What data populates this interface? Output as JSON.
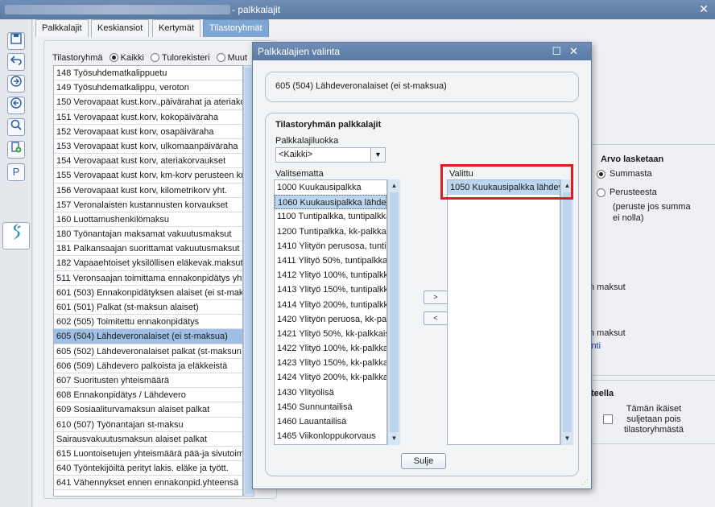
{
  "window": {
    "title": "- palkkalajit",
    "close_label": "✕"
  },
  "toolbar_icons": [
    "save-icon",
    "undo-icon",
    "forward-icon",
    "back-icon",
    "search-icon",
    "add-page-icon",
    "p-icon",
    "app-logo-icon"
  ],
  "toolbar_p_label": "P",
  "tabs": [
    {
      "label": "Palkkalajit",
      "active": false
    },
    {
      "label": "Keskiansiot",
      "active": false
    },
    {
      "label": "Kertymät",
      "active": false
    },
    {
      "label": "Tilastoryhmät",
      "active": true
    }
  ],
  "left_panel": {
    "filter_label": "Tilastoryhmä",
    "filter_options": [
      "Kaikki",
      "Tulorekisteri",
      "Muut"
    ],
    "rows": [
      "148 Työsuhdematkalippuetu",
      "149 Työsuhdematkalippu, veroton",
      "150 Verovapaat kust.korv.,päivärahat ja ateriako",
      "151 Verovapaat kust.korv, kokopäiväraha",
      "152 Verovapaat kust korv, osapäiväraha",
      "153 Verovapaat kust korv, ulkomaanpäiväraha",
      "154 Verovapaat kust korv, ateriakorvaukset",
      "155 Verovapaat kust korv, km-korv perusteen kr",
      "156 Verovapaat kust korv, kilometrikorv yht.",
      "157 Veronalaisten kustannusten korvaukset",
      "160 Luottamushenkilömaksu",
      "180 Työnantajan maksamat vakuutusmaksut",
      "181 Palkansaajan suorittamat vakuutusmaksut",
      "182 Vapaaehtoiset yksilöllisen eläkevak.maksut",
      "511 Veronsaajan toimittama ennakonpidätys yht",
      "601 (503) Ennakonpidätyksen alaiset (ei st-mak",
      "601 (501) Palkat (st-maksun alaiset)",
      "602 (505) Toimitettu ennakonpidätys",
      "605 (504) Lähdeveronalaiset (ei st-maksua)",
      "605 (502) Lähdeveronalaiset palkat (st-maksun",
      "606 (509) Lähdevero palkoista ja eläkkeistä",
      "607 Suoritusten yhteismäärä",
      "608 Ennakonpidätys / Lähdevero",
      "609 Sosiaaliturvamaksun alaiset palkat",
      "610 (507) Työnantajan st-maksu",
      "Sairausvakuutusmaksun alaiset palkat",
      "615 Luontoisetujen yhteismäärä pää-ja sivutoim",
      "640 Työntekijöiltä perityt lakis. eläke ja tyött.",
      "641 Vähennykset ennen ennakonpid.yhteensä"
    ],
    "selected_index": 18
  },
  "right_panel": {
    "arvo_title": "Arvo lasketaan",
    "option_summasta": "Summasta",
    "option_perusteesta": "Perusteesta",
    "note": "(peruste jos summa ei nolla)",
    "frag_maksut_1": "n maksut",
    "frag_maksut_2": "n maksut",
    "frag_link": "inti",
    "teella_title": "teella",
    "teella_check_label": "Tämän ikäiset suljetaan pois tilastoryhmästä"
  },
  "modal": {
    "title": "Palkkalajien valinta",
    "maximize_label": "☐",
    "close_label": "✕",
    "selected_group": "605 (504) Lähdeveronalaiset (ei st-maksua)",
    "group_title": "Tilastoryhmän palkkalajit",
    "class_label": "Palkkalajiluokka",
    "class_value": "<Kaikki>",
    "available_label": "Valitsematta",
    "available": [
      "1000 Kuukausipalkka",
      "1060 Kuukausipalkka lähdev",
      "1100 Tuntipalkka, tuntipalkka",
      "1200 Tuntipalkka, kk-palkkai",
      "1410 Ylityön perusosa, tuntip",
      "1411 Ylityö 50%, tuntipalkka",
      "1412 Ylityö 100%, tuntipalkka",
      "1413 Ylityö 150%, tuntipalkka",
      "1414 Ylityö 200%, tuntipalkka",
      "1420 Ylityön peruosa, kk-palk",
      "1421 Ylityö 50%, kk-palkkais",
      "1422 Ylityö 100%, kk-palkka",
      "1423 Ylityö 150%, kk-palkka",
      "1424 Ylityö 200%, kk-palkka",
      "1430 Ylityölisä",
      "1450 Sunnuntailisä",
      "1460 Lauantailisä",
      "1465 Viikonloppukorvaus"
    ],
    "available_highlight": 1,
    "chosen_label": "Valittu",
    "chosen": [
      "1050 Kuukausipalkka lähdev"
    ],
    "add_label": ">",
    "remove_label": "<",
    "ok_label": "Sulje"
  },
  "colors": {
    "highlight_frame": "#e01b1b",
    "titlebar": "#5b7aa3",
    "selection": "#9fc0e4"
  }
}
